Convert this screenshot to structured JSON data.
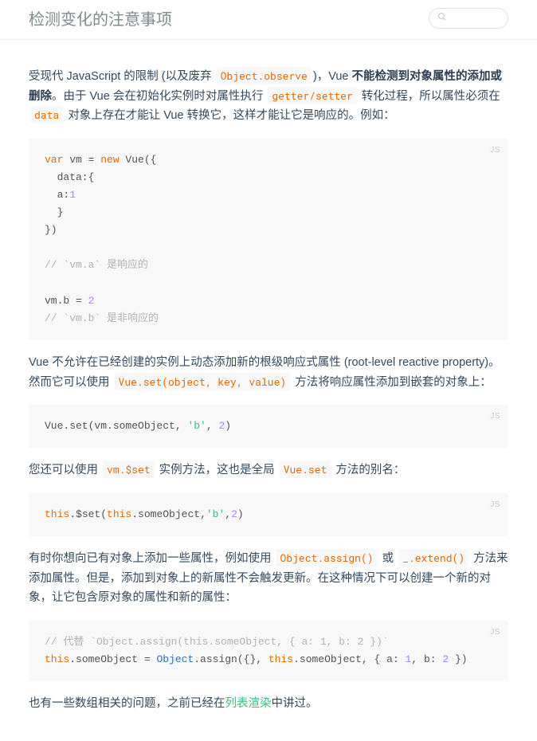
{
  "header": {
    "title": "检测变化的注意事项",
    "search_placeholder": ""
  },
  "para1": {
    "t1": "受现代 JavaScript 的限制 (以及废弃 ",
    "c1": "Object.observe",
    "t2": ")，Vue ",
    "b1": "不能检测到对象属性的添加或删除",
    "t3": "。由于 Vue 会在初始化实例时对属性执行 ",
    "c2": "getter/setter",
    "t4": " 转化过程，所以属性必须在 ",
    "c3": "data",
    "t5": " 对象上存在才能让 Vue 转换它，这样才能让它是响应的。例如："
  },
  "code1": {
    "lang": "JS",
    "l1a": "var",
    "l1b": " vm = ",
    "l1c": "new",
    "l1d": " Vue({",
    "l2": "  data:{",
    "l3a": "  a:",
    "l3b": "1",
    "l4": "  }",
    "l5": "})",
    "l6": "",
    "l7": "// `vm.a` 是响应的",
    "l8": "",
    "l9a": "vm.b = ",
    "l9b": "2",
    "l10": "// `vm.b` 是非响应的"
  },
  "para2": {
    "t1": "Vue 不允许在已经创建的实例上动态添加新的根级响应式属性 (root-level reactive property)。然而它可以使用 ",
    "c1": "Vue.set(object, key, value)",
    "t2": " 方法将响应属性添加到嵌套的对象上："
  },
  "code2": {
    "lang": "JS",
    "l1a": "Vue.set(vm.someObject, ",
    "l1b": "'b'",
    "l1c": ", ",
    "l1d": "2",
    "l1e": ")"
  },
  "para3": {
    "t1": "您还可以使用 ",
    "c1": "vm.$set",
    "t2": " 实例方法，这也是全局 ",
    "c2": "Vue.set",
    "t3": " 方法的别名："
  },
  "code3": {
    "lang": "JS",
    "l1a": "this",
    "l1b": ".$set(",
    "l1c": "this",
    "l1d": ".someObject,",
    "l1e": "'b'",
    "l1f": ",",
    "l1g": "2",
    "l1h": ")"
  },
  "para4": {
    "t1": "有时你想向已有对象上添加一些属性，例如使用 ",
    "c1": "Object.assign()",
    "t2": " 或 ",
    "c2": "_.extend()",
    "t3": " 方法来添加属性。但是，添加到对象上的新属性不会触发更新。在这种情况下可以创建一个新的对象，让它包含原对象的属性和新的属性："
  },
  "code4": {
    "lang": "JS",
    "l1": "// 代替 `Object.assign(this.someObject, { a: 1, b: 2 })`",
    "l2a": "this",
    "l2b": ".someObject = ",
    "l2c": "Object",
    "l2d": ".assign({}, ",
    "l2e": "this",
    "l2f": ".someObject, { ",
    "l2g": "a",
    "l2h": ": ",
    "l2i": "1",
    "l2j": ", ",
    "l2k": "b",
    "l2l": ": ",
    "l2m": "2",
    "l2n": " })"
  },
  "para5": {
    "t1": "也有一些数组相关的问题，之前已经在",
    "link": "列表渲染",
    "t2": "中讲过。"
  }
}
